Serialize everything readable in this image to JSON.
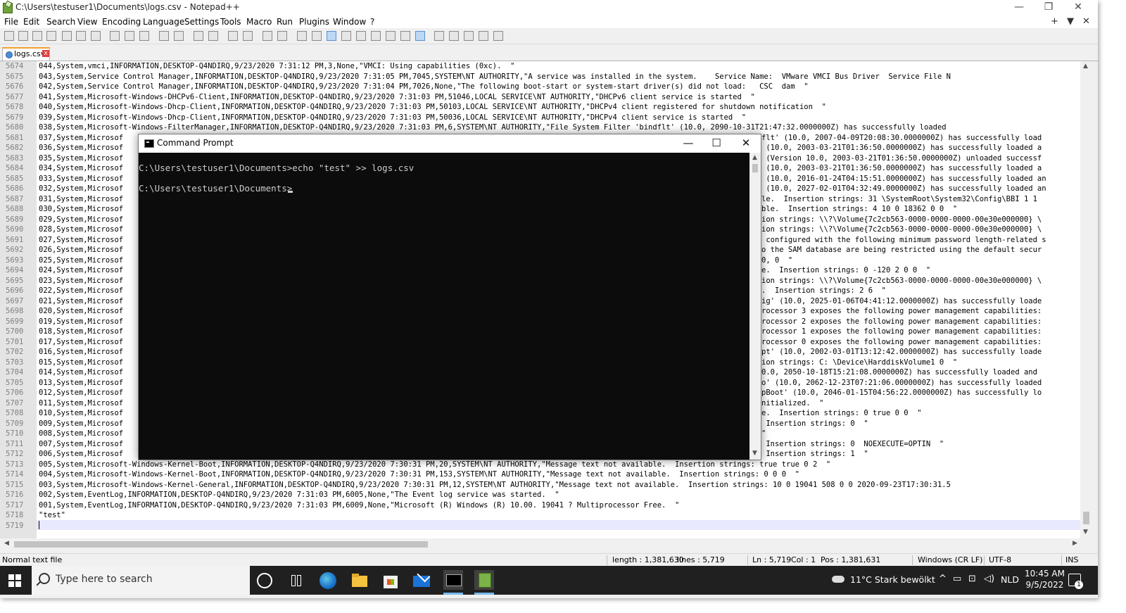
{
  "window": {
    "title": "C:\\Users\\testuser1\\Documents\\logs.csv - Notepad++",
    "minimize": "—",
    "restore": "❐",
    "close": "✕"
  },
  "menu": {
    "items": [
      "File",
      "Edit",
      "Search",
      "View",
      "Encoding",
      "Language",
      "Settings",
      "Tools",
      "Macro",
      "Run",
      "Plugins",
      "Window",
      "?"
    ],
    "right": [
      "+",
      "▼",
      "✕"
    ]
  },
  "tab": {
    "label": "logs.csv",
    "close": "x"
  },
  "editor": {
    "lines": [
      {
        "n": "5674",
        "t": "044,System,vmci,INFORMATION,DESKTOP-Q4NDIRQ,9/23/2020 7:31:12 PM,3,None,\"VMCI: Using capabilities (0xc).  \""
      },
      {
        "n": "5675",
        "t": "043,System,Service Control Manager,INFORMATION,DESKTOP-Q4NDIRQ,9/23/2020 7:31:05 PM,7045,SYSTEM\\NT AUTHORITY,\"A service was installed in the system.    Service Name:  VMware VMCI Bus Driver  Service File N"
      },
      {
        "n": "5676",
        "t": "042,System,Service Control Manager,INFORMATION,DESKTOP-Q4NDIRQ,9/23/2020 7:31:04 PM,7026,None,\"The following boot-start or system-start driver(s) did not load:   CSC  dam  \""
      },
      {
        "n": "5677",
        "t": "041,System,Microsoft-Windows-DHCPv6-Client,INFORMATION,DESKTOP-Q4NDIRQ,9/23/2020 7:31:03 PM,51046,LOCAL SERVICE\\NT AUTHORITY,\"DHCPv6 client service is started  \""
      },
      {
        "n": "5678",
        "t": "040,System,Microsoft-Windows-Dhcp-Client,INFORMATION,DESKTOP-Q4NDIRQ,9/23/2020 7:31:03 PM,50103,LOCAL SERVICE\\NT AUTHORITY,\"DHCPv4 client registered for shutdown notification  \""
      },
      {
        "n": "5679",
        "t": "039,System,Microsoft-Windows-Dhcp-Client,INFORMATION,DESKTOP-Q4NDIRQ,9/23/2020 7:31:03 PM,50036,LOCAL SERVICE\\NT AUTHORITY,\"DHCPv4 client service is started  \""
      },
      {
        "n": "5680",
        "t": "038,System,Microsoft-Windows-FilterManager,INFORMATION,DESKTOP-Q4NDIRQ,9/23/2020 7:31:03 PM,6,SYSTEM\\NT AUTHORITY,\"File System Filter 'bindflt' (10.0, 2090-10-31T21:47:32.0000000Z) has successfully loaded"
      },
      {
        "n": "5681",
        "t": "037,System,Microsof",
        "r": "flt' (10.0, 2007-04-09T20:08:30.0000000Z) has successfully load"
      },
      {
        "n": "5682",
        "t": "036,System,Microsof",
        "r": " (10.0, 2003-03-21T01:36:50.0000000Z) has successfully loaded a"
      },
      {
        "n": "5683",
        "t": "035,System,Microsof",
        "r": " (Version 10.0, 2003-03-21T01:36:50.0000000Z) unloaded successf"
      },
      {
        "n": "5684",
        "t": "034,System,Microsof",
        "r": " (10.0, 2003-03-21T01:36:50.0000000Z) has successfully loaded a"
      },
      {
        "n": "5685",
        "t": "033,System,Microsof",
        "r": " (10.0, 2016-01-24T04:15:51.0000000Z) has successfully loaded an"
      },
      {
        "n": "5686",
        "t": "032,System,Microsof",
        "r": " (10.0, 2027-02-01T04:32:49.0000000Z) has successfully loaded an"
      },
      {
        "n": "5687",
        "t": "031,System,Microsof",
        "r": "le.  Insertion strings: 31 \\SystemRoot\\System32\\Config\\BBI 1 1"
      },
      {
        "n": "5688",
        "t": "030,System,Microsof",
        "r": "ble.  Insertion strings: 4 10 0 18362 0 0  \""
      },
      {
        "n": "5689",
        "t": "029,System,Microsof",
        "r": "ion strings: \\\\?\\Volume{7c2cb563-0000-0000-0000-00e30e000000} \\"
      },
      {
        "n": "5690",
        "t": "028,System,Microsof",
        "r": "ion strings: \\\\?\\Volume{7c2cb563-0000-0000-0000-00e30e000000} \\"
      },
      {
        "n": "5691",
        "t": "027,System,Microsof",
        "r": " configured with the following minimum password length-related s"
      },
      {
        "n": "5692",
        "t": "026,System,Microsof",
        "r": "o the SAM database are being restricted using the default secur"
      },
      {
        "n": "5693",
        "t": "025,System,Microsof",
        "r": "0, 0  \""
      },
      {
        "n": "5694",
        "t": "024,System,Microsof",
        "r": "e.  Insertion strings: 0 -120 2 0 0  \""
      },
      {
        "n": "5695",
        "t": "023,System,Microsof",
        "r": "ion strings: \\\\?\\Volume{7c2cb563-0000-0000-0000-00e30e000000} \\"
      },
      {
        "n": "5696",
        "t": "022,System,Microsof",
        "r": ".  Insertion strings: 2 6  \""
      },
      {
        "n": "5697",
        "t": "021,System,Microsof",
        "r": "ig' (10.0, 2025-01-06T04:41:12.0000000Z) has successfully loade"
      },
      {
        "n": "5698",
        "t": "020,System,Microsof",
        "r": "rocessor 3 exposes the following power management capabilities:"
      },
      {
        "n": "5699",
        "t": "019,System,Microsof",
        "r": "rocessor 2 exposes the following power management capabilities:"
      },
      {
        "n": "5700",
        "t": "018,System,Microsof",
        "r": "rocessor 1 exposes the following power management capabilities:"
      },
      {
        "n": "5701",
        "t": "017,System,Microsof",
        "r": "rocessor 0 exposes the following power management capabilities:"
      },
      {
        "n": "5702",
        "t": "016,System,Microsof",
        "r": "pt' (10.0, 2002-03-01T13:12:42.0000000Z) has successfully loade"
      },
      {
        "n": "5703",
        "t": "015,System,Microsof",
        "r": "ion strings: C: \\Device\\HarddiskVolume1 0  \""
      },
      {
        "n": "5704",
        "t": "014,System,Microsof",
        "r": "0.0, 2050-10-18T15:21:08.0000000Z) has successfully loaded and"
      },
      {
        "n": "5705",
        "t": "013,System,Microsof",
        "r": "o' (10.0, 2062-12-23T07:21:06.0000000Z) has successfully loaded"
      },
      {
        "n": "5706",
        "t": "012,System,Microsof",
        "r": "pBoot' (10.0, 2046-01-15T04:56:22.0000000Z) has successfully lo"
      },
      {
        "n": "5707",
        "t": "011,System,Microsof",
        "r": "nitialized.  \""
      },
      {
        "n": "5708",
        "t": "010,System,Microsof",
        "r": "e.  Insertion strings: 0 true 0 0  \""
      },
      {
        "n": "5709",
        "t": "009,System,Microsof",
        "r": " Insertion strings: 0  \""
      },
      {
        "n": "5710",
        "t": "008,System,Microsof",
        "r": "\""
      },
      {
        "n": "5711",
        "t": "007,System,Microsof",
        "r": " Insertion strings: 0  NOEXECUTE=OPTIN  \""
      },
      {
        "n": "5712",
        "t": "006,System,Microsof",
        "r": " Insertion strings: 1  \""
      },
      {
        "n": "5713",
        "t": "005,System,Microsoft-Windows-Kernel-Boot,INFORMATION,DESKTOP-Q4NDIRQ,9/23/2020 7:30:31 PM,20,SYSTEM\\NT AUTHORITY,\"Message text not available.  Insertion strings: true true 0 2  \""
      },
      {
        "n": "5714",
        "t": "004,System,Microsoft-Windows-Kernel-Boot,INFORMATION,DESKTOP-Q4NDIRQ,9/23/2020 7:30:31 PM,153,SYSTEM\\NT AUTHORITY,\"Message text not available.  Insertion strings: 0 0 0  \""
      },
      {
        "n": "5715",
        "t": "003,System,Microsoft-Windows-Kernel-General,INFORMATION,DESKTOP-Q4NDIRQ,9/23/2020 7:30:31 PM,12,SYSTEM\\NT AUTHORITY,\"Message text not available.  Insertion strings: 10 0 19041 508 0 0 2020-09-23T17:30:31.5"
      },
      {
        "n": "5716",
        "t": "002,System,EventLog,INFORMATION,DESKTOP-Q4NDIRQ,9/23/2020 7:31:03 PM,6005,None,\"The Event log service was started.  \""
      },
      {
        "n": "5717",
        "t": "001,System,EventLog,INFORMATION,DESKTOP-Q4NDIRQ,9/23/2020 7:31:03 PM,6009,None,\"Microsoft (R) Windows (R) 10.00. 19041 ? Multiprocessor Free.  \""
      },
      {
        "n": "5718",
        "t": "\"test\""
      },
      {
        "n": "5719",
        "t": ""
      }
    ]
  },
  "statusbar": {
    "filetype": "Normal text file",
    "length": "length : 1,381,630",
    "lines": "lines : 5,719",
    "ln": "Ln : 5,719",
    "col": "Col : 1",
    "pos": "Pos : 1,381,631",
    "eol": "Windows (CR LF)",
    "encoding": "UTF-8",
    "mode": "INS"
  },
  "cmd": {
    "title": "Command Prompt",
    "line1": "C:\\Users\\testuser1\\Documents>echo \"test\" >> logs.csv",
    "line2": "C:\\Users\\testuser1\\Documents>",
    "minimize": "—",
    "maximize": "☐",
    "close": "✕"
  },
  "taskbar": {
    "search_placeholder": "Type here to search",
    "weather": "11°C  Stark bewölkt",
    "language": "NLD",
    "time": "10:45 AM",
    "date": "9/5/2022",
    "notification_count": "1"
  }
}
